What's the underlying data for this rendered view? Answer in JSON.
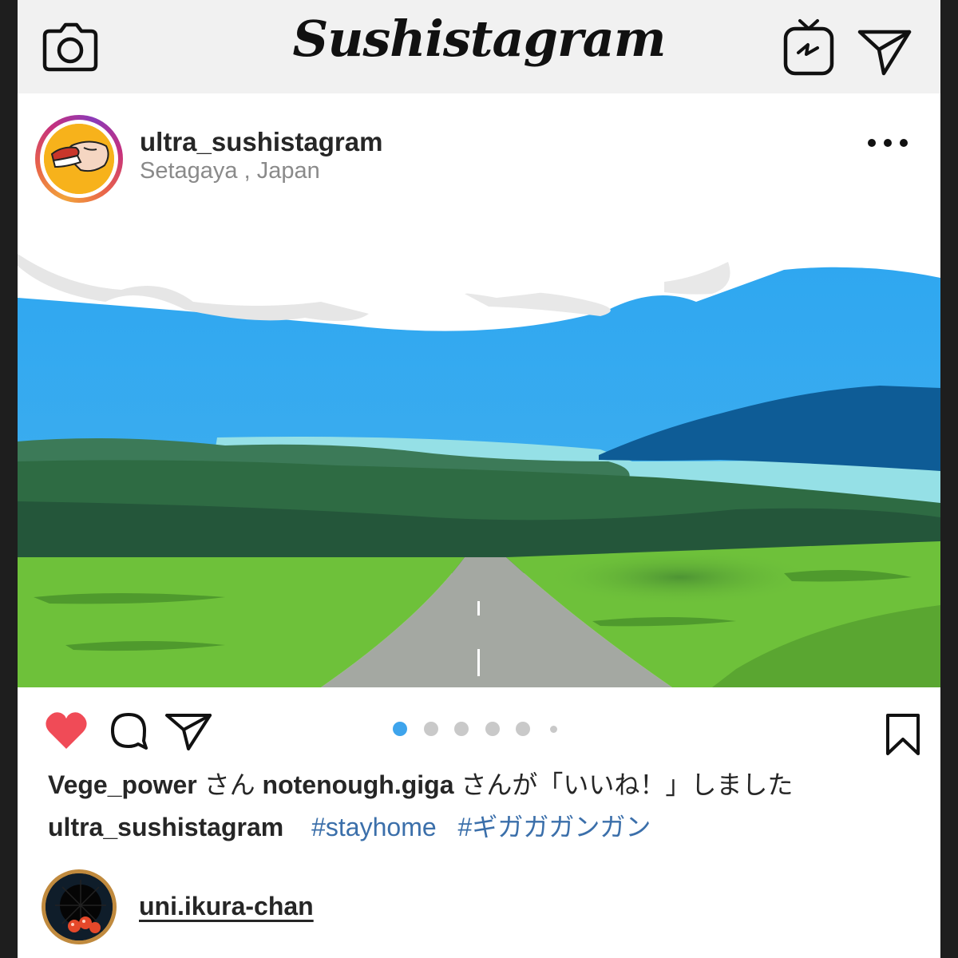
{
  "app": {
    "title": "Sushistagram",
    "icons": [
      "camera-icon",
      "igtv-icon",
      "direct-send-icon"
    ]
  },
  "post": {
    "username": "ultra_sushistagram",
    "location": "Setagaya , Japan",
    "more_icon": "more-options-icon",
    "photo": "landscape illustration with sky, clouds, mountain, lake, forest, fields and road",
    "carousel": {
      "count": 6,
      "active_index": 0,
      "accent_color": "#3ea4ec"
    },
    "liked": true,
    "like_color": "#f04b57"
  },
  "likes": {
    "user1": "Vege_power",
    "san1": "さん",
    "user2": "notenough.giga",
    "suffix": "さんが「いいね！」しました"
  },
  "caption": {
    "user": "ultra_sushistagram",
    "tags": [
      "#stayhome",
      "#ギガガガンガン"
    ]
  },
  "comment": {
    "user": "uni.ikura-chan"
  },
  "colors": {
    "sky": "#38aaf0",
    "mountain": "#0e5c96",
    "lake": "#95e0e6",
    "forest": "#2e6b43",
    "grass": "#6ec13a",
    "road": "#a4a8a2",
    "hashtag": "#3b6faa"
  }
}
